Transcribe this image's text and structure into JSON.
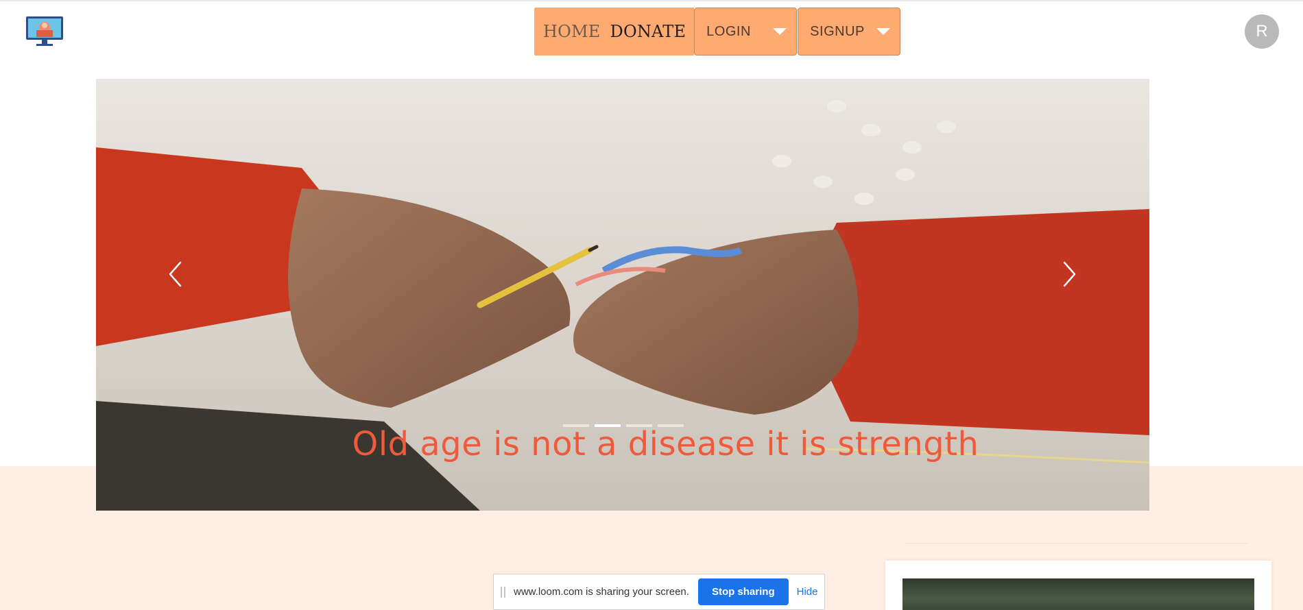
{
  "header": {
    "logo_icon": "computer-monitor-logo-icon",
    "nav": {
      "home_label": "HOME",
      "donate_label": "DONATE"
    },
    "login_dropdown": {
      "label": "LOGIN",
      "icon": "caret-down-icon"
    },
    "signup_dropdown": {
      "label": "SIGNUP",
      "icon": "caret-down-icon"
    },
    "avatar_initial": "R"
  },
  "carousel": {
    "caption": "Old age is not a disease it is strength",
    "indicator_count": 4,
    "active_index": 1,
    "prev_icon": "chevron-left-icon",
    "next_icon": "chevron-right-icon"
  },
  "screen_share": {
    "message": "www.loom.com is sharing your screen.",
    "stop_label": "Stop sharing",
    "hide_label": "Hide"
  },
  "colors": {
    "nav_accent": "#ffaa71",
    "caption": "#f05a3c",
    "band": "#feeee4",
    "share_button": "#1a73e8"
  }
}
